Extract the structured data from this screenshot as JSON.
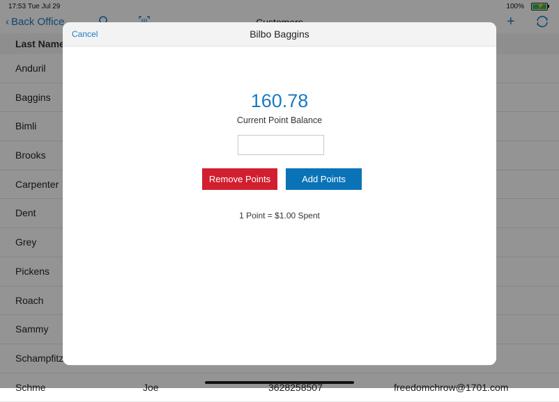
{
  "status_bar": {
    "time": "17:53",
    "date": "Tue Jul 29",
    "battery_pct": "100%",
    "battery_level": 1.0
  },
  "nav": {
    "back_label": "Back Office",
    "title": "Customers",
    "icons": [
      "search-icon",
      "barcode-scan-icon",
      "plus-icon",
      "refresh-icon"
    ]
  },
  "table": {
    "header": "Last Name",
    "rows": [
      {
        "last": "Anduril",
        "first": "",
        "phone": "",
        "email": ""
      },
      {
        "last": "Baggins",
        "first": "",
        "phone": "",
        "email": ""
      },
      {
        "last": "Bimli",
        "first": "",
        "phone": "",
        "email": ""
      },
      {
        "last": "Brooks",
        "first": "",
        "phone": "",
        "email": ""
      },
      {
        "last": "Carpenter",
        "first": "",
        "phone": "",
        "email": ""
      },
      {
        "last": "Dent",
        "first": "",
        "phone": "",
        "email": ""
      },
      {
        "last": "Grey",
        "first": "",
        "phone": "",
        "email": ""
      },
      {
        "last": "Pickens",
        "first": "",
        "phone": "",
        "email": "om"
      },
      {
        "last": "Roach",
        "first": "",
        "phone": "",
        "email": ""
      },
      {
        "last": "Sammy",
        "first": "",
        "phone": "",
        "email": ""
      },
      {
        "last": "Schampfitz",
        "first": "",
        "phone": "",
        "email": "m"
      },
      {
        "last": "Schme",
        "first": "Joe",
        "phone": "3628258507",
        "email": "freedomchrow@1701.com"
      }
    ]
  },
  "modal": {
    "cancel_label": "Cancel",
    "title": "Bilbo Baggins",
    "balance": "160.78",
    "balance_label": "Current Point Balance",
    "points_input_value": "",
    "remove_label": "Remove Points",
    "add_label": "Add Points",
    "rate_text": "1 Point = $1.00 Spent"
  },
  "colors": {
    "accent": "#1a7bc0",
    "remove": "#d11f2f",
    "add": "#0a73b7"
  }
}
